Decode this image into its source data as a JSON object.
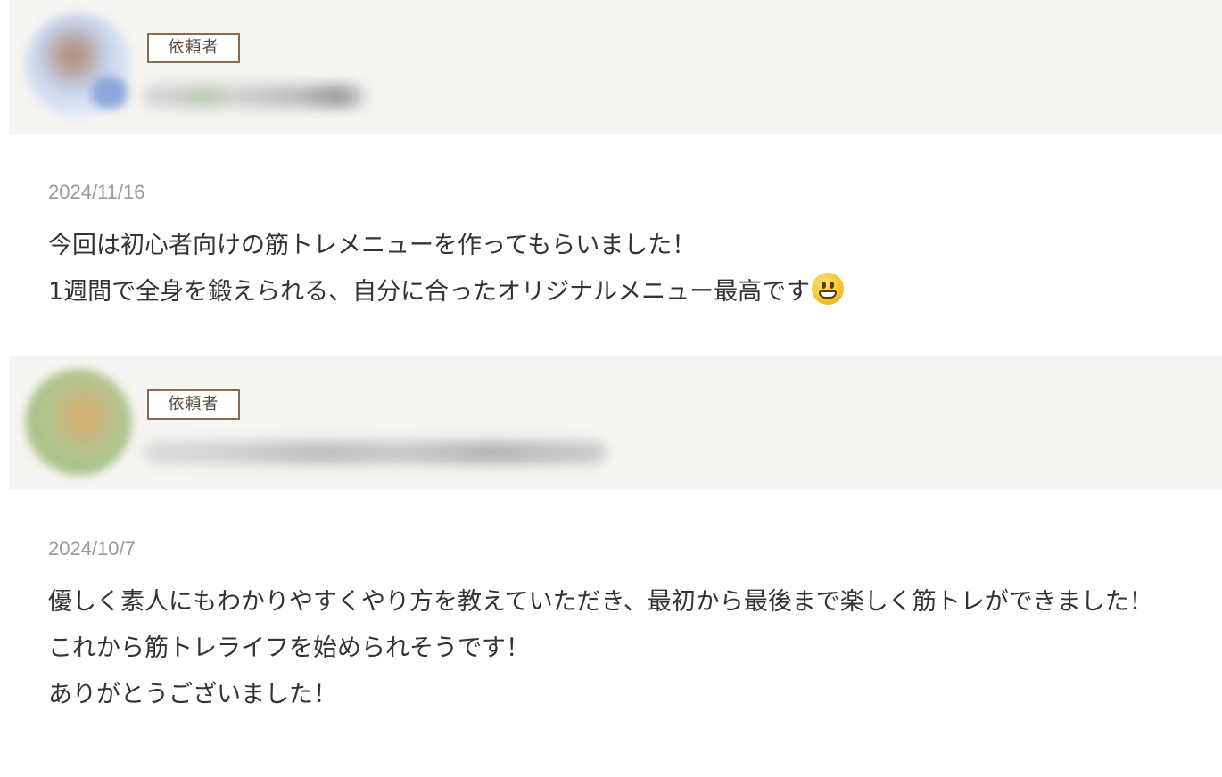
{
  "reviews": [
    {
      "role": "依頼者",
      "date": "2024/11/16",
      "text": "今回は初心者向けの筋トレメニューを作ってもらいました！\n1週間で全身を鍛えられる、自分に合ったオリジナルメニュー最高です",
      "emoji": "grinning-face-emoji"
    },
    {
      "role": "依頼者",
      "date": "2024/10/7",
      "text": "優しく素人にもわかりやすくやり方を教えていただき、最初から最後まで楽しく筋トレができました！\nこれから筋トレライフを始められそうです！\nありがとうございました！"
    }
  ]
}
